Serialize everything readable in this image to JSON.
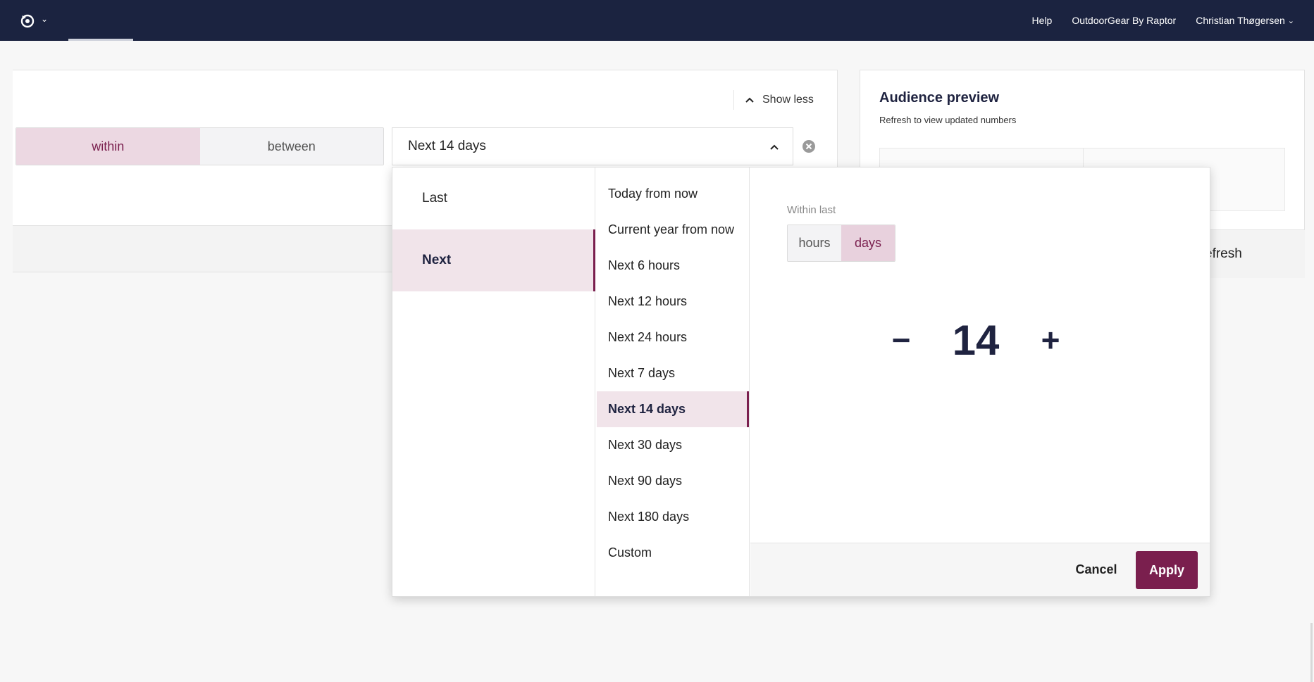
{
  "topbar": {
    "help": "Help",
    "org": "OutdoorGear By Raptor",
    "user": "Christian Thøgersen"
  },
  "filter": {
    "show_less": "Show less",
    "mode_within": "within",
    "mode_between": "between",
    "selected_range": "Next 14 days"
  },
  "audience": {
    "title": "Audience preview",
    "subtitle": "Refresh to view updated numbers",
    "refresh_partial": "efresh"
  },
  "dropdown": {
    "directions": [
      "Last",
      "Next"
    ],
    "presets": [
      "Today from now",
      "Current year from now",
      "Next 6 hours",
      "Next 12 hours",
      "Next 24 hours",
      "Next 7 days",
      "Next 14 days",
      "Next 30 days",
      "Next 90 days",
      "Next 180 days",
      "Custom"
    ],
    "within_label": "Within last",
    "unit_hours": "hours",
    "unit_days": "days",
    "minus": "−",
    "value": "14",
    "plus": "+",
    "cancel": "Cancel",
    "apply": "Apply"
  },
  "colors": {
    "topbar": "#1b2340",
    "accent": "#7a1f4e",
    "accent_light": "#f1e4ea"
  }
}
